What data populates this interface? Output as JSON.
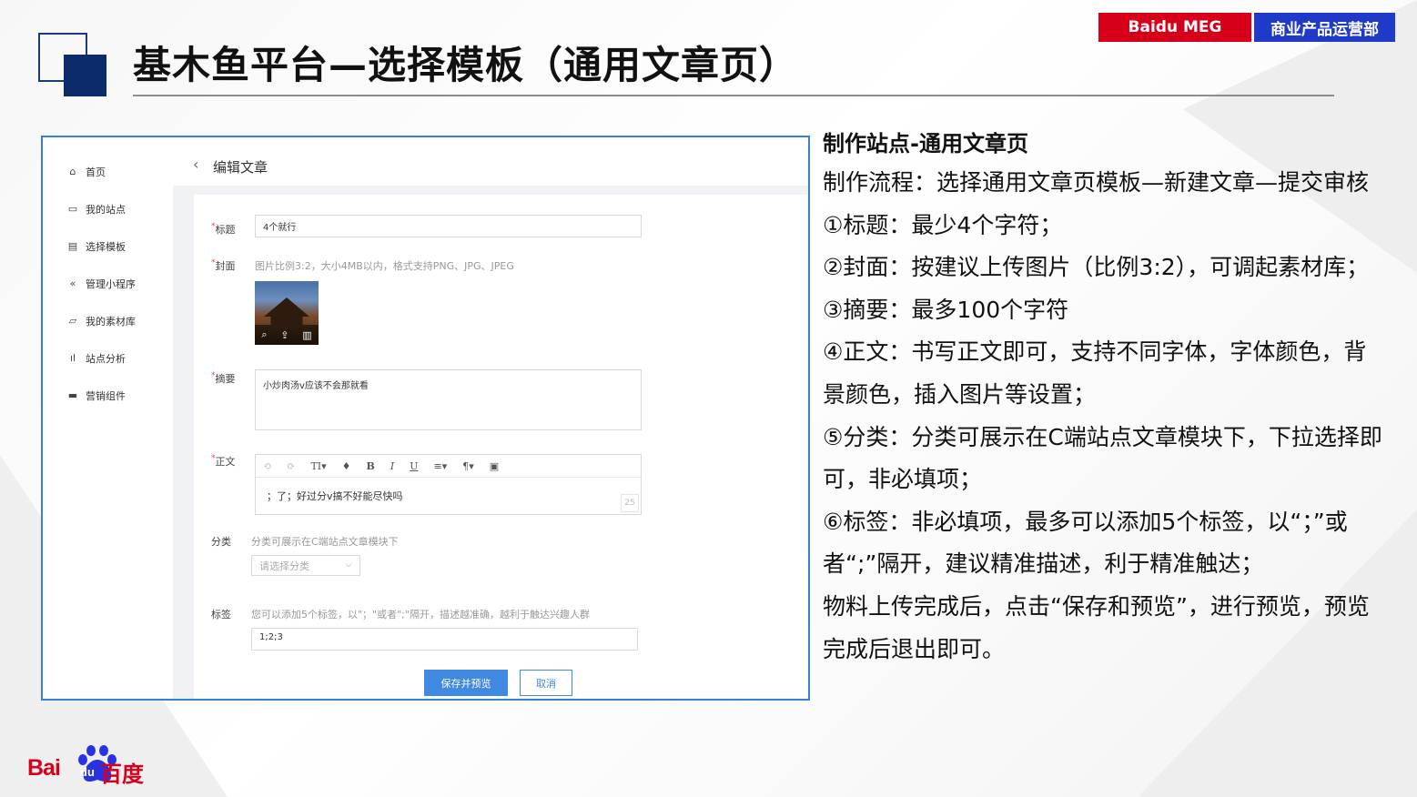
{
  "colors": {
    "accent_red": "#d7001b",
    "accent_blue": "#1f39c9",
    "frame_blue": "#3a7fd5",
    "primary_button": "#3f8ae0"
  },
  "slide": {
    "title": "基木鱼平台—选择模板（通用文章页）"
  },
  "badges": {
    "left": "Baidu MEG",
    "right": "商业产品运营部"
  },
  "app": {
    "sidebar": [
      {
        "label": "首页",
        "icon": "home-icon"
      },
      {
        "label": "我的站点",
        "icon": "site-icon"
      },
      {
        "label": "选择模板",
        "icon": "template-icon"
      },
      {
        "label": "管理小程序",
        "icon": "miniprogram-icon"
      },
      {
        "label": "我的素材库",
        "icon": "image-library-icon"
      },
      {
        "label": "站点分析",
        "icon": "bar-chart-icon"
      },
      {
        "label": "营销组件",
        "icon": "component-icon"
      }
    ],
    "header": {
      "title": "编辑文章"
    },
    "form": {
      "title_label": "标题",
      "title_value": "4个就行",
      "cover_label": "封面",
      "cover_hint": "图片比例3:2，大小4MB以内，格式支持PNG、JPG、JPEG",
      "summary_label": "摘要",
      "summary_value": "小炒肉汤v应该不会那就看",
      "body_label": "正文",
      "body_value": "；了；好过分v搞不好能尽快吗",
      "body_counter": "25",
      "toolbar": [
        "⟲",
        "⟳",
        "TI▾",
        "♦",
        "B",
        "I",
        "U",
        "≡▾",
        "¶▾",
        "▣"
      ],
      "category_label": "分类",
      "category_hint": "分类可展示在C端站点文章模块下",
      "category_placeholder": "请选择分类",
      "tags_label": "标签",
      "tags_hint": "您可以添加5个标签，以\"；\"或者\";\"隔开，描述越准确，越利于触达兴趣人群",
      "tags_value": "1;2;3",
      "save_button": "保存并预览",
      "cancel_button": "取消"
    }
  },
  "notes": {
    "heading": "制作站点-通用文章页",
    "lines": [
      "制作流程：选择通用文章页模板—新建文章—提交审核",
      "①标题：最少4个字符；",
      "②封面：按建议上传图片（比例3:2），可调起素材库；",
      "③摘要：最多100个字符",
      "④正文：书写正文即可，支持不同字体，字体颜色，背景颜色，插入图片等设置；",
      "⑤分类：分类可展示在C端站点文章模块下，下拉选择即可，非必填项；",
      "⑥标签：非必填项，最多可以添加5个标签，以“；”或者“;”隔开，建议精准描述，利于精准触达；",
      "物料上传完成后，点击“保存和预览”，进行预览，预览完成后退出即可。"
    ]
  },
  "logo": {
    "latin": "Bai",
    "du": "du",
    "chinese": "百度"
  }
}
